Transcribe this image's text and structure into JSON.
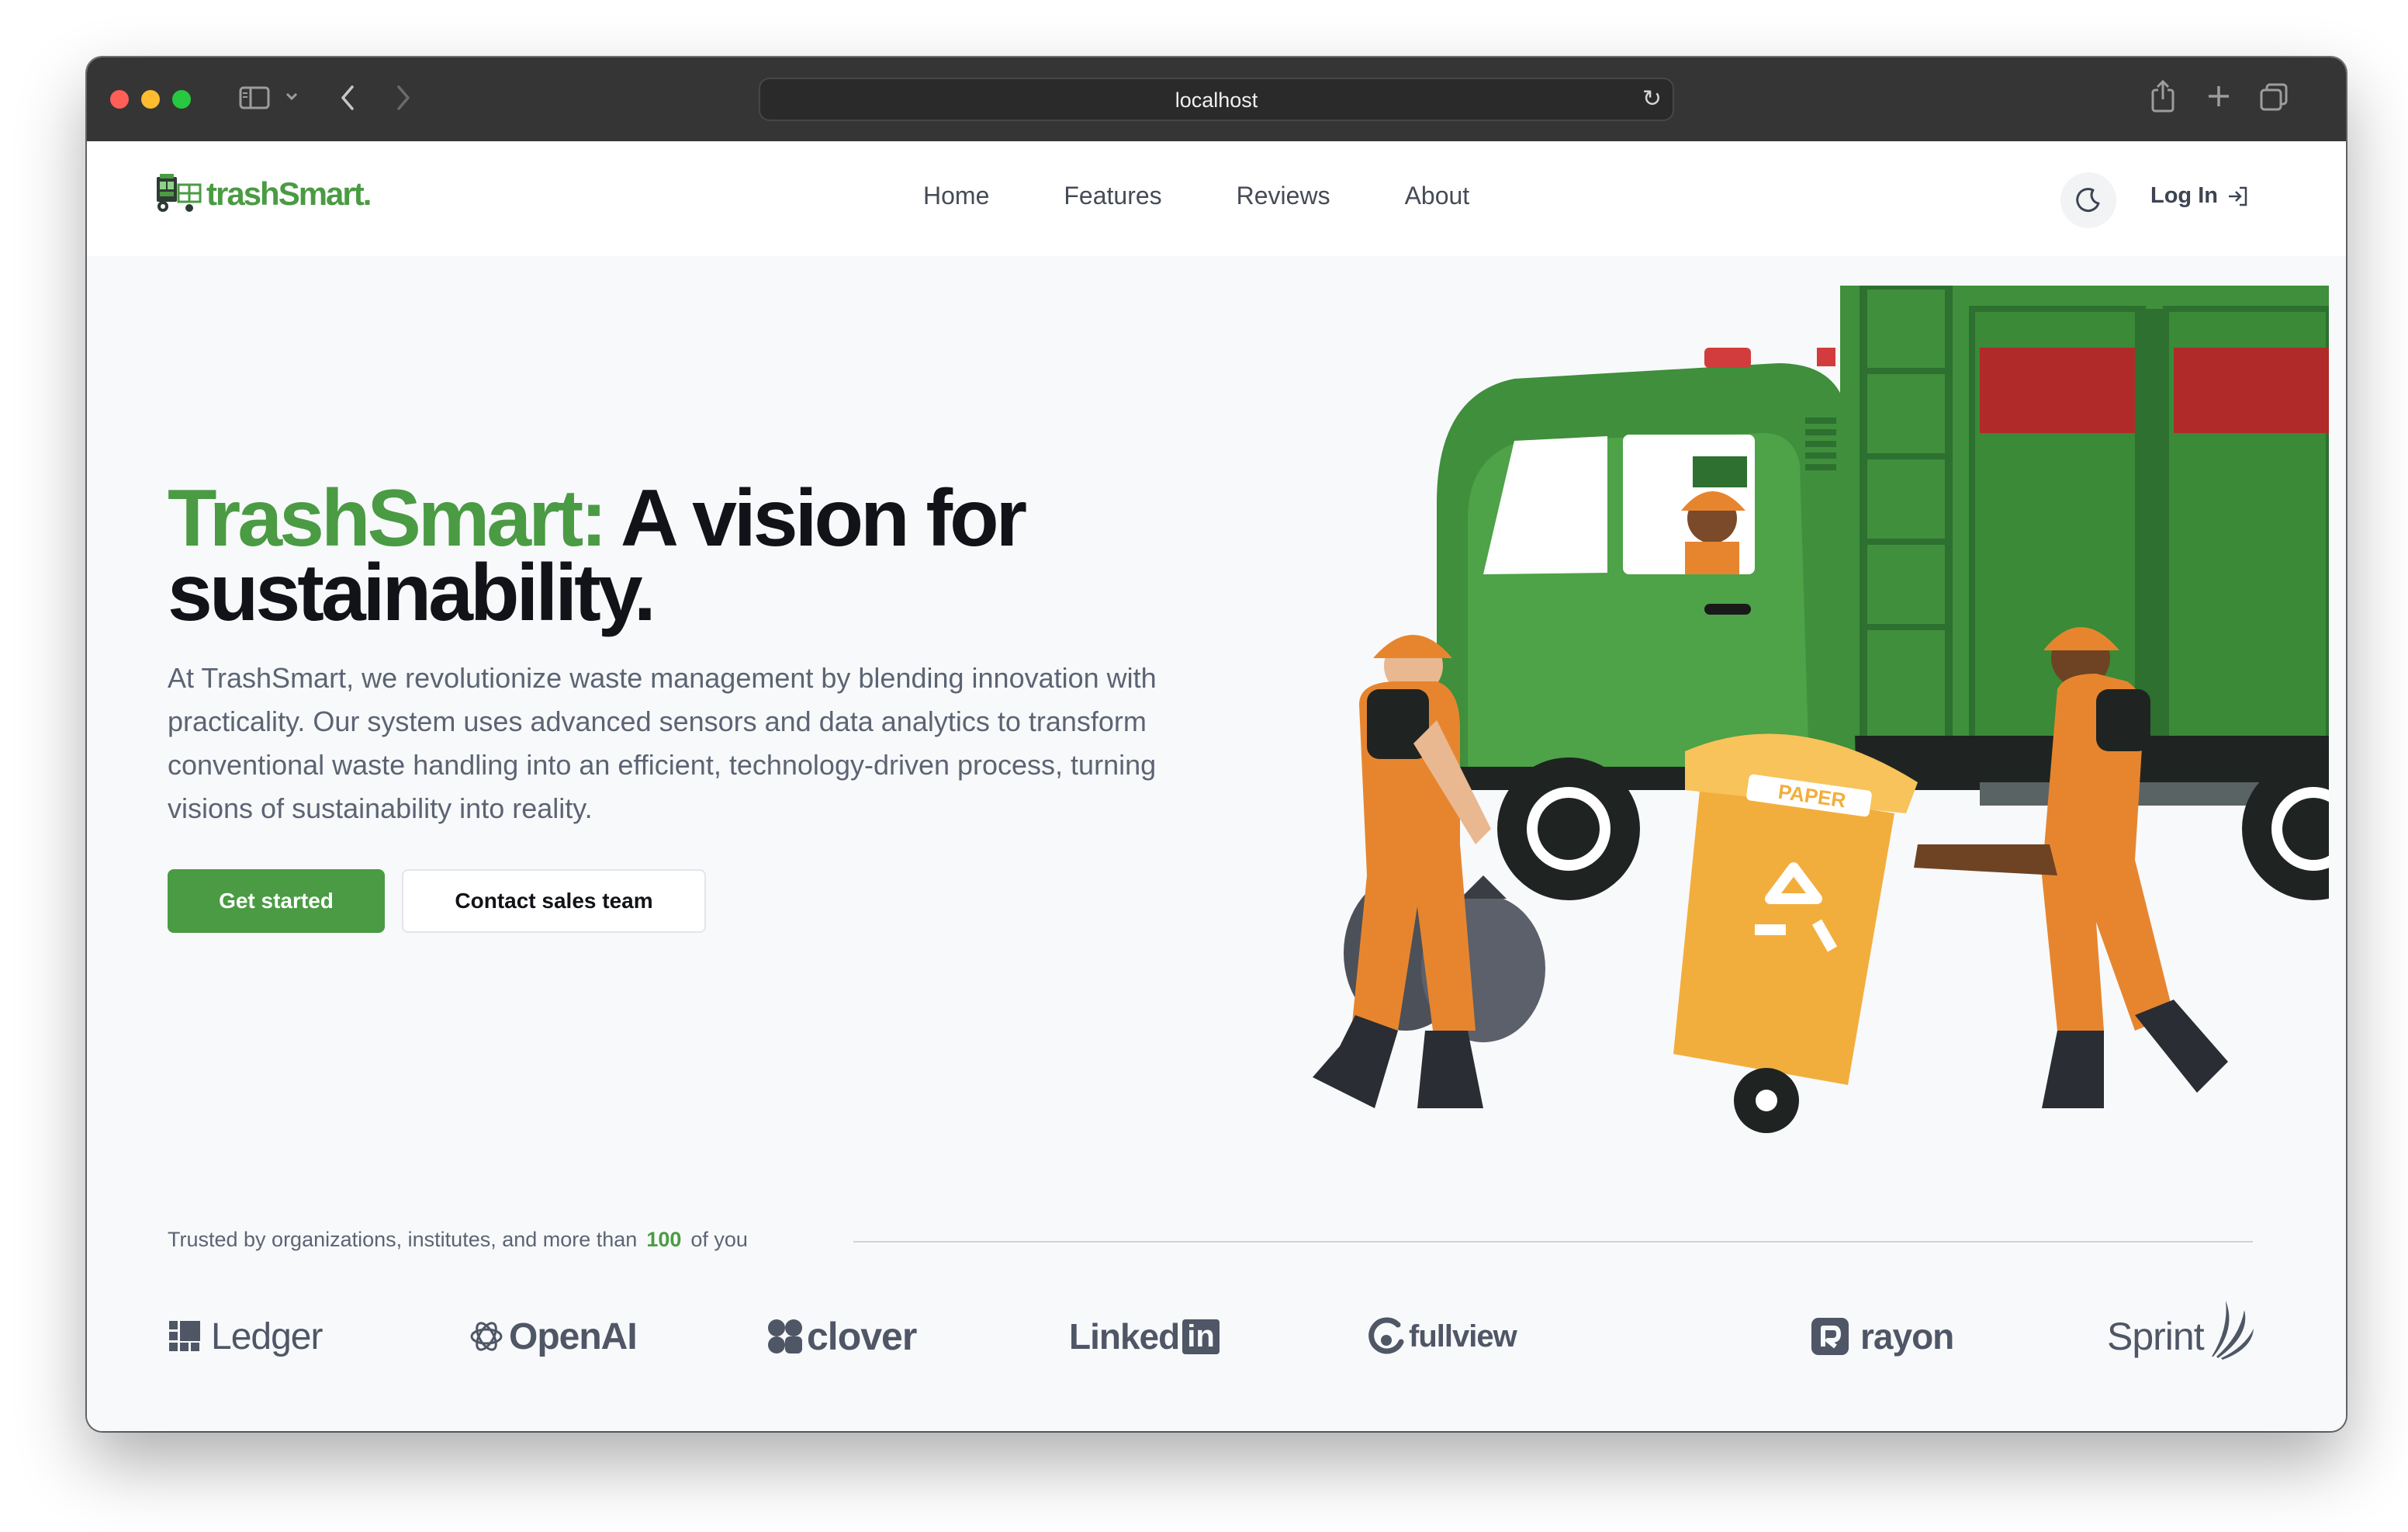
{
  "browser": {
    "url": "localhost",
    "traffic_lights": {
      "close": "#ff5f57",
      "minimize": "#febc2e",
      "maximize": "#28c840"
    }
  },
  "nav": {
    "brand": "trashSmart",
    "brand_dot": ".",
    "links": [
      "Home",
      "Features",
      "Reviews",
      "About"
    ],
    "theme_icon": "moon-icon",
    "login_label": "Log In"
  },
  "hero": {
    "title_green": "TrashSmart:",
    "title_rest": " A vision for sustainability.",
    "description": "At TrashSmart, we revolutionize waste management by blending innovation with practicality. Our system uses advanced sensors and data analytics to transform conventional waste handling into an efficient, technology-driven process, turning visions of sustainability into reality.",
    "primary_cta": "Get started",
    "secondary_cta": "Contact sales team",
    "illustration_bin_label": "PAPER"
  },
  "trusted": {
    "prefix": "Trusted by organizations, institutes, and more than",
    "count": "100",
    "suffix": "of you"
  },
  "logos": [
    "Ledger",
    "OpenAI",
    "clover",
    "Linked",
    "in",
    "fullview",
    "rayon",
    "Sprint"
  ],
  "colors": {
    "brand_green": "#4a9b43",
    "text_dark": "#111318",
    "text_muted": "#5c6473",
    "page_bg": "#f8f9fb"
  }
}
